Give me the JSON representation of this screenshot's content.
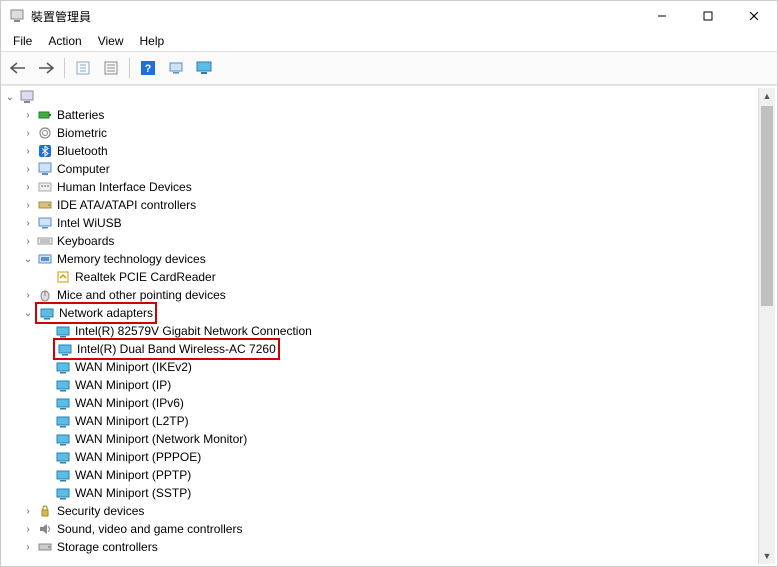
{
  "window": {
    "title": "裝置管理員"
  },
  "menu": {
    "file": "File",
    "action": "Action",
    "view": "View",
    "help": "Help"
  },
  "toolbar": {
    "back": "back-icon",
    "forward": "forward-icon",
    "show_hidden": "show-hidden-icon",
    "properties": "properties-icon",
    "help": "help-icon",
    "scan": "scan-icon",
    "monitor": "monitor-icon"
  },
  "tree": {
    "root": {
      "label": "",
      "expanded": true
    },
    "batteries": "Batteries",
    "biometric": "Biometric",
    "bluetooth": "Bluetooth",
    "computer": "Computer",
    "hid": "Human Interface Devices",
    "ide": "IDE ATA/ATAPI controllers",
    "intel_wiusb": "Intel WiUSB",
    "keyboards": "Keyboards",
    "memory_tech": {
      "label": "Memory technology devices",
      "realtek": "Realtek PCIE CardReader"
    },
    "mice": "Mice and other pointing devices",
    "network_adapters": {
      "label": "Network adapters",
      "items": [
        "Intel(R) 82579V Gigabit Network Connection",
        "Intel(R) Dual Band Wireless-AC 7260",
        "WAN Miniport (IKEv2)",
        "WAN Miniport (IP)",
        "WAN Miniport (IPv6)",
        "WAN Miniport (L2TP)",
        "WAN Miniport (Network Monitor)",
        "WAN Miniport (PPPOE)",
        "WAN Miniport (PPTP)",
        "WAN Miniport (SSTP)"
      ]
    },
    "security_devices": "Security devices",
    "sound": "Sound, video and game controllers",
    "storage": "Storage controllers"
  }
}
